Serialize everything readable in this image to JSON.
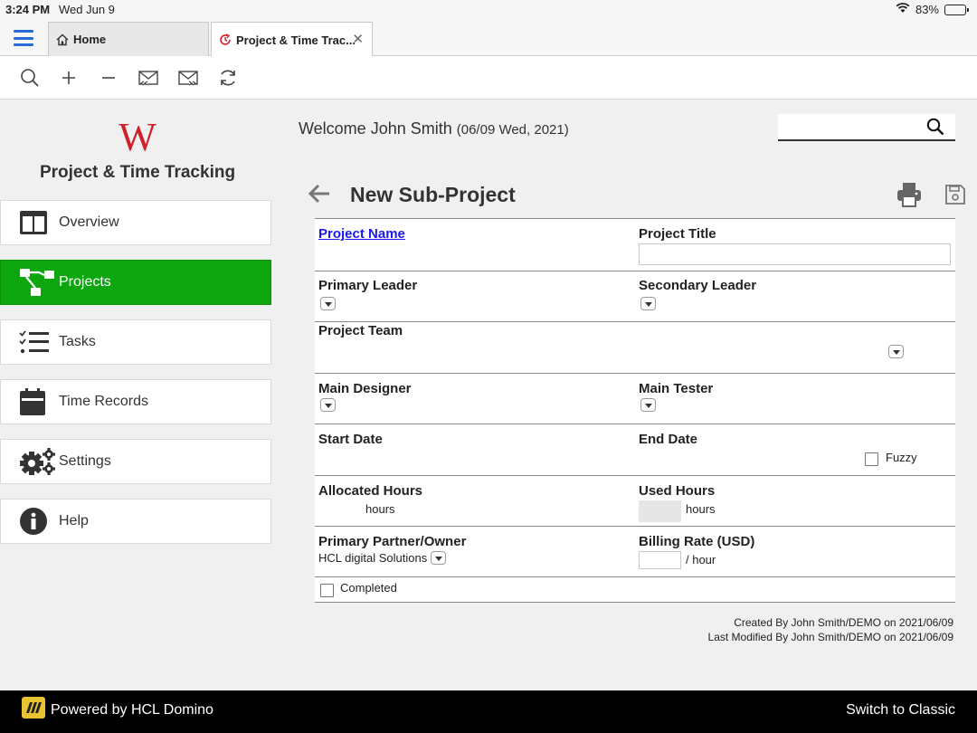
{
  "status_bar": {
    "time": "3:24 PM",
    "date": "Wed Jun 9",
    "battery": "83%",
    "battery_level": 0.83
  },
  "tabs": [
    {
      "label": "Home",
      "icon": "home-icon"
    },
    {
      "label": "Project & Time Trac...",
      "icon": "clock-refresh-icon"
    }
  ],
  "toolbar": {
    "icons": [
      "search-icon",
      "plus-icon",
      "minus-icon",
      "mail-reply-icon",
      "mail-forward-icon",
      "refresh-icon"
    ]
  },
  "sidebar": {
    "logo_letter": "W",
    "title": "Project & Time Tracking",
    "items": [
      {
        "label": "Overview",
        "icon": "overview-icon",
        "active": false
      },
      {
        "label": "Projects",
        "icon": "projects-icon",
        "active": true
      },
      {
        "label": "Tasks",
        "icon": "tasks-icon",
        "active": false
      },
      {
        "label": "Time Records",
        "icon": "calendar-icon",
        "active": false
      },
      {
        "label": "Settings",
        "icon": "gear-icon",
        "active": false
      },
      {
        "label": "Help",
        "icon": "info-icon",
        "active": false
      }
    ]
  },
  "header": {
    "welcome_prefix": "Welcome John Smith",
    "welcome_date": "(06/09 Wed, 2021)",
    "search_placeholder": ""
  },
  "page": {
    "title": "New Sub-Project"
  },
  "form": {
    "project_name_label": "Project Name",
    "project_title_label": "Project Title",
    "primary_leader_label": "Primary Leader",
    "secondary_leader_label": "Secondary Leader",
    "project_team_label": "Project Team",
    "main_designer_label": "Main Designer",
    "main_tester_label": "Main Tester",
    "start_date_label": "Start Date",
    "end_date_label": "End Date",
    "fuzzy_label": "Fuzzy",
    "allocated_hours_label": "Allocated Hours",
    "allocated_unit": "hours",
    "used_hours_label": "Used Hours",
    "used_unit": "hours",
    "primary_partner_label": "Primary Partner/Owner",
    "primary_partner_value": "HCL digital Solutions",
    "billing_rate_label": "Billing Rate (USD)",
    "billing_unit": "/ hour",
    "completed_label": "Completed"
  },
  "audit": {
    "created": "Created By John Smith/DEMO on 2021/06/09",
    "modified": "Last Modified By John Smith/DEMO on 2021/06/09"
  },
  "footer": {
    "powered": "Powered by HCL Domino",
    "switch": "Switch to Classic"
  },
  "colors": {
    "accent_green": "#0ea60e",
    "link_blue": "#1a1aee",
    "brand_red": "#d0202a",
    "menu_blue": "#2a6cd6"
  }
}
